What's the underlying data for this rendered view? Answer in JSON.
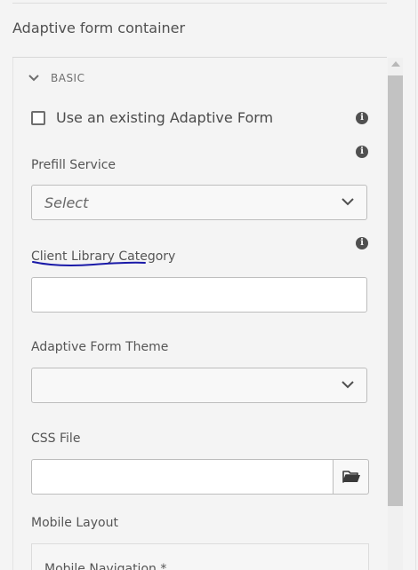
{
  "panel": {
    "title": "Adaptive form container"
  },
  "section": {
    "label": "BASIC",
    "chevron_icon": "chevron-down-icon"
  },
  "fields": {
    "use_existing_label": "Use an existing Adaptive Form",
    "prefill_label": "Prefill Service",
    "prefill_value": "Select",
    "client_lib_label": "Client Library Category",
    "client_lib_value": "",
    "theme_label": "Adaptive Form Theme",
    "theme_value": "",
    "css_label": "CSS File",
    "css_value": "",
    "mobile_label": "Mobile Layout",
    "mobile_nav_label": "Mobile Navigation *"
  },
  "icons": {
    "info": "info-icon",
    "dropdown": "chevron-down-icon",
    "folder": "folder-open-icon"
  },
  "colors": {
    "annotation_underline": "#1a1aa8"
  }
}
